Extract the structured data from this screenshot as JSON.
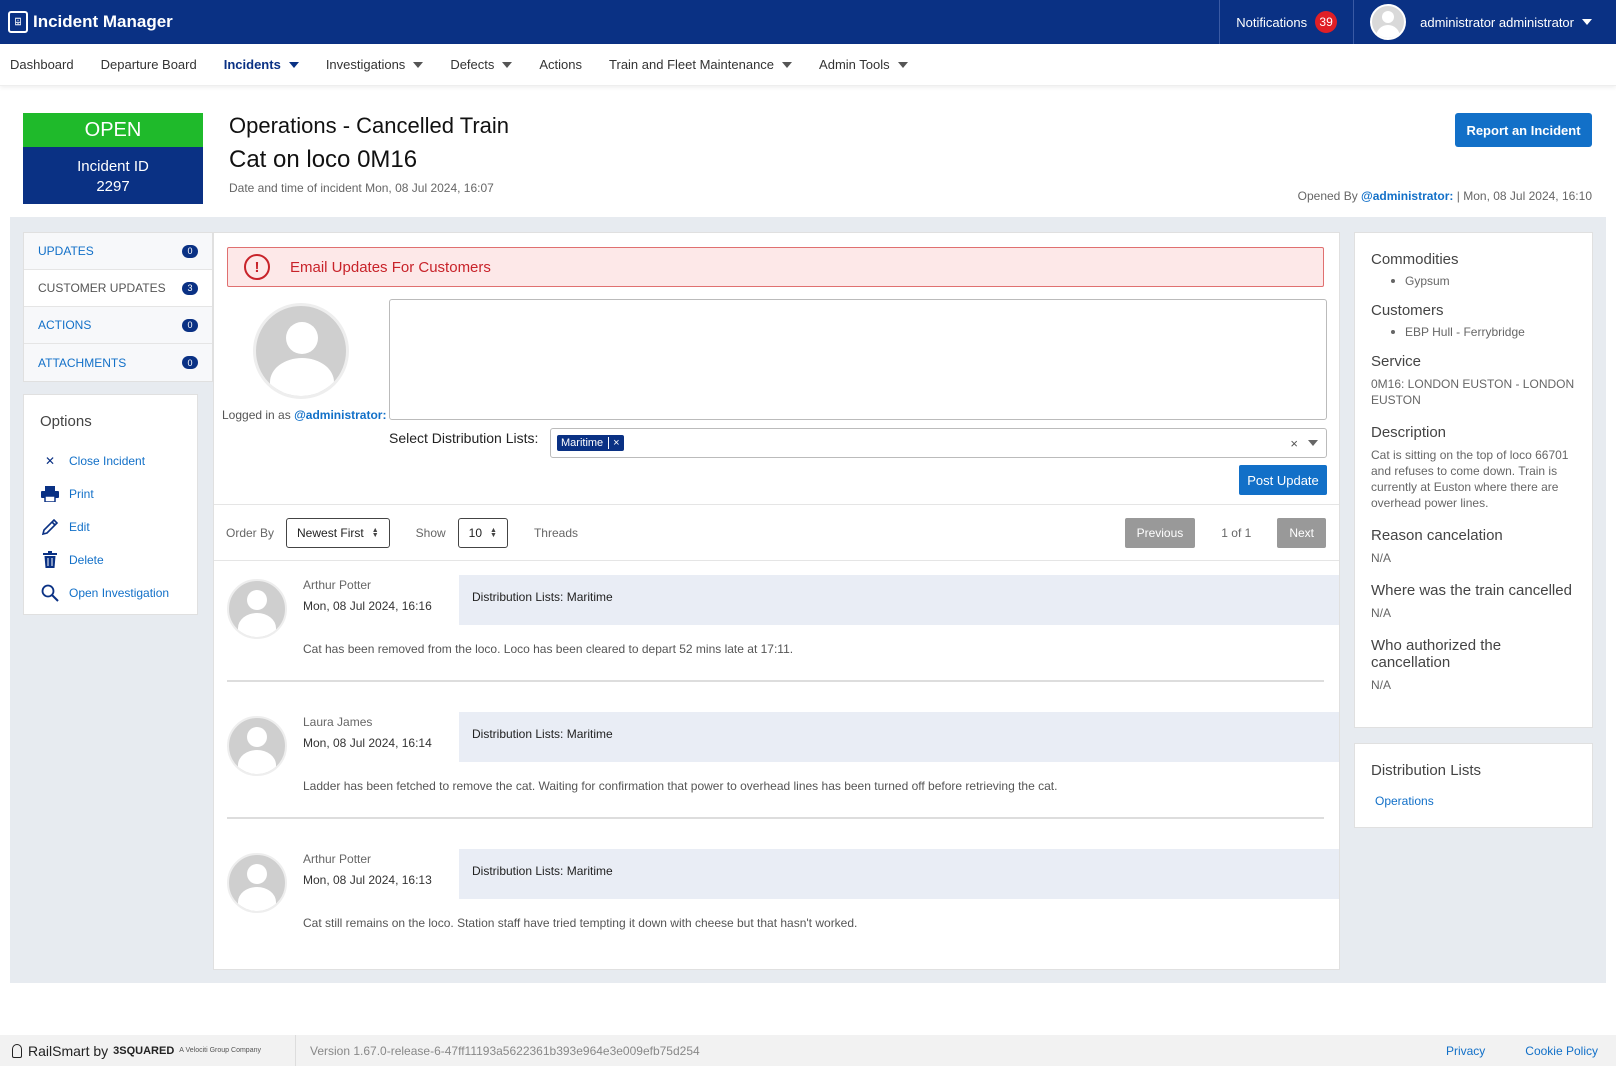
{
  "app": {
    "title": "Incident Manager",
    "logo_glyph": "⌹"
  },
  "topbar": {
    "notifications_label": "Notifications",
    "notifications_count": "39",
    "user_name": "administrator administrator"
  },
  "nav": {
    "items": [
      {
        "label": "Dashboard"
      },
      {
        "label": "Departure Board"
      },
      {
        "label": "Incidents"
      },
      {
        "label": "Investigations"
      },
      {
        "label": "Defects"
      },
      {
        "label": "Actions"
      },
      {
        "label": "Train and Fleet Maintenance"
      },
      {
        "label": "Admin Tools"
      }
    ]
  },
  "incident": {
    "status": "OPEN",
    "id_label": "Incident ID",
    "id": "2297",
    "category": "Operations - Cancelled Train",
    "title": "Cat on loco 0M16",
    "date_line": "Date and time of incident Mon, 08 Jul 2024, 16:07",
    "report_button": "Report an Incident",
    "opened_by_prefix": "Opened By",
    "opened_by_user": "@administrator:",
    "opened_by_suffix": "| Mon, 08 Jul 2024, 16:10"
  },
  "tabs": [
    {
      "label": "UPDATES",
      "count": "0"
    },
    {
      "label": "CUSTOMER UPDATES",
      "count": "3"
    },
    {
      "label": "ACTIONS",
      "count": "0"
    },
    {
      "label": "ATTACHMENTS",
      "count": "0"
    }
  ],
  "options": {
    "title": "Options",
    "items": [
      {
        "label": "Close Incident",
        "icon": "close-icon",
        "glyph": "✕"
      },
      {
        "label": "Print",
        "icon": "print-icon",
        "glyph": "🖶"
      },
      {
        "label": "Edit",
        "icon": "edit-icon",
        "glyph": "✎"
      },
      {
        "label": "Delete",
        "icon": "trash-icon",
        "glyph": "🗑"
      },
      {
        "label": "Open Investigation",
        "icon": "search-icon",
        "glyph": "⌕"
      }
    ]
  },
  "composer": {
    "alert": "Email Updates For Customers",
    "alert_glyph": "!",
    "logged_in_prefix": "Logged in as",
    "logged_in_user": "@administrator:",
    "textarea_value": "",
    "dist_label": "Select Distribution Lists:",
    "dist_selected": "Maritime",
    "chip_remove": "×",
    "clear_glyph": "×",
    "post_button": "Post Update"
  },
  "list_controls": {
    "order_label": "Order By",
    "order_value": "Newest First",
    "show_label": "Show",
    "show_value": "10",
    "threads_label": "Threads",
    "previous": "Previous",
    "page": "1 of 1",
    "next": "Next"
  },
  "threads": [
    {
      "author": "Arthur Potter",
      "date": "Mon, 08 Jul 2024, 16:16",
      "dist": "Distribution Lists: Maritime",
      "body": "Cat has been removed from the loco.  Loco has been cleared to depart 52 mins late at 17:11."
    },
    {
      "author": "Laura James",
      "date": "Mon, 08 Jul 2024, 16:14",
      "dist": "Distribution Lists: Maritime",
      "body": "Ladder has been fetched to remove the cat.  Waiting for confirmation that power to overhead lines has been turned off before retrieving the cat."
    },
    {
      "author": "Arthur Potter",
      "date": "Mon, 08 Jul 2024, 16:13",
      "dist": "Distribution Lists: Maritime",
      "body": "Cat still remains on the loco.  Station staff have tried tempting it down with cheese but that hasn't worked."
    }
  ],
  "details": {
    "commodities_label": "Commodities",
    "commodities": [
      "Gypsum"
    ],
    "customers_label": "Customers",
    "customers": [
      "EBP Hull - Ferrybridge"
    ],
    "service_label": "Service",
    "service": "0M16: LONDON EUSTON - LONDON EUSTON",
    "description_label": "Description",
    "description": "Cat is sitting on the top of loco 66701 and refuses to come down.  Train is currently at Euston where there are overhead power lines.",
    "reason_label": "Reason cancelation",
    "reason": "N/A",
    "where_label": "Where was the train cancelled",
    "where": "N/A",
    "who_label": "Who authorized the cancellation",
    "who": "N/A"
  },
  "distribution": {
    "title": "Distribution Lists",
    "items": [
      "Operations"
    ]
  },
  "footer": {
    "brand": "RailSmart by",
    "brand_company": "3SQUARED",
    "brand_tagline": "A Velociti Group Company",
    "version": "Version 1.67.0-release-6-47ff11193a5622361b393e964e3e009efb75d254",
    "privacy": "Privacy",
    "cookie": "Cookie Policy"
  },
  "colors": {
    "brand_navy": "#0a3184",
    "open_green": "#1fba2b",
    "primary_blue": "#1270c8",
    "alert_red": "#c8232a"
  }
}
